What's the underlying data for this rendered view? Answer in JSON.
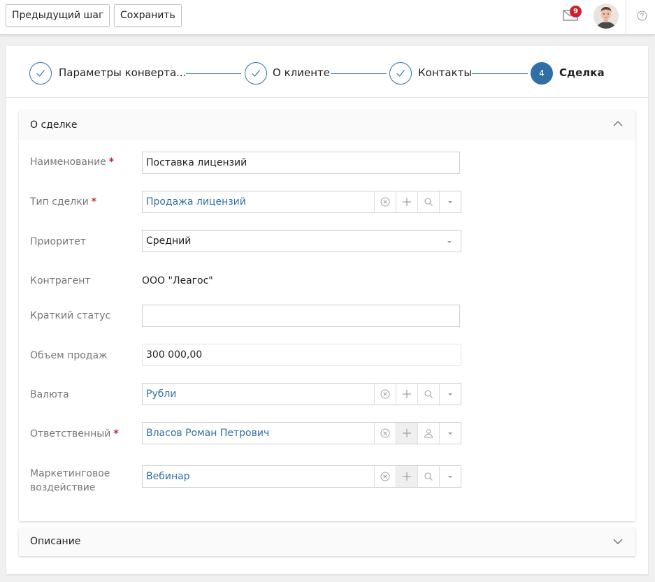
{
  "toolbar": {
    "prev_label": "Предыдущий шаг",
    "save_label": "Сохранить",
    "mail_count": "9"
  },
  "steps": [
    {
      "label": "Параметры конверта...",
      "state": "done"
    },
    {
      "label": "О клиенте",
      "state": "done"
    },
    {
      "label": "Контакты",
      "state": "done"
    },
    {
      "label": "Сделка",
      "state": "active",
      "number": "4"
    }
  ],
  "deal_section": {
    "title": "О сделке",
    "fields": {
      "name": {
        "label": "Наименование",
        "value": "Поставка лицензий",
        "required": "*"
      },
      "type": {
        "label": "Тип сделки",
        "value": "Продажа лицензий",
        "required": "*"
      },
      "priority": {
        "label": "Приоритет",
        "value": "Средний"
      },
      "counterparty": {
        "label": "Контрагент",
        "value": "ООО \"Леагос\""
      },
      "status": {
        "label": "Краткий статус",
        "value": ""
      },
      "volume": {
        "label": "Объем продаж",
        "value": "300 000,00"
      },
      "currency": {
        "label": "Валюта",
        "value": "Рубли"
      },
      "responsible": {
        "label": "Ответственный",
        "value": "Власов Роман Петрович",
        "required": "*"
      },
      "marketing": {
        "label_line1": "Маркетинговое",
        "label_line2": "воздействие",
        "value": "Вебинар"
      }
    }
  },
  "description_section": {
    "title": "Описание"
  },
  "colors": {
    "accent": "#2f6fa6",
    "required": "#d0202f",
    "badge": "#d0202f"
  }
}
